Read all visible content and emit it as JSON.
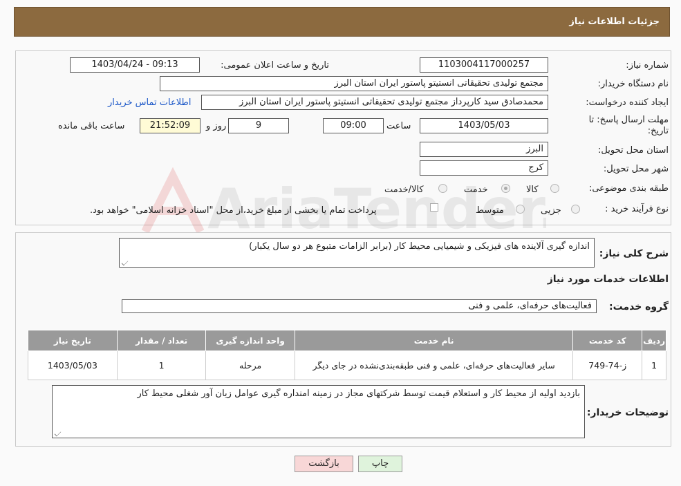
{
  "header": {
    "title": "جزئیات اطلاعات نیاز"
  },
  "need_info": {
    "need_number_label": "شماره نیاز:",
    "need_number": "1103004117000257",
    "announce_label": "تاریخ و ساعت اعلان عمومی:",
    "announce_value": "1403/04/24 - 09:13",
    "buyer_org_label": "نام دستگاه خریدار:",
    "buyer_org": "مجتمع تولیدی تحقیقاتی انستیتو پاستور ایران استان البرز",
    "requester_label": "ایجاد کننده درخواست:",
    "requester": "محمدصادق سید کارپرداز مجتمع تولیدی تحقیقاتی انستیتو پاستور ایران استان البرز",
    "contact_link": "اطلاعات تماس خریدار",
    "deadline_label_1": "مهلت ارسال پاسخ: تا",
    "deadline_label_2": "تاریخ:",
    "deadline_date": "1403/05/03",
    "time_label": "ساعت",
    "deadline_time": "09:00",
    "days_value": "9",
    "days_label": "روز و",
    "remaining_time": "21:52:09",
    "remaining_label": "ساعت باقی مانده",
    "province_label": "استان محل تحویل:",
    "province": "البرز",
    "city_label": "شهر محل تحویل:",
    "city": "کرج",
    "category_label": "طبقه بندی موضوعی:",
    "category_options": [
      "کالا",
      "خدمت",
      "کالا/خدمت"
    ],
    "category_selected": "خدمت",
    "process_label": "نوع فرآیند خرید :",
    "process_options": [
      "جزیی",
      "متوسط"
    ],
    "payment_note": "پرداخت تمام یا بخشی از مبلغ خرید،از محل \"اسناد خزانه اسلامی\" خواهد بود."
  },
  "watermark": {
    "text": "AriaTender.neT"
  },
  "description": {
    "label": "شرح کلی نیاز:",
    "value": "اندازه گیری آلاینده های فیزیکی و شیمیایی محیط کار (برابر الزامات متبوع هر دو سال یکبار)"
  },
  "services": {
    "title": "اطلاعات خدمات مورد نیاز",
    "group_label": "گروه خدمت:",
    "group_value": "فعالیت‌های حرفه‌ای، علمی و فنی",
    "columns": [
      "ردیف",
      "کد خدمت",
      "نام خدمت",
      "واحد اندازه گیری",
      "تعداد / مقدار",
      "تاریخ نیاز"
    ],
    "rows": [
      {
        "row": "1",
        "code": "ز-74-749",
        "name": "سایر فعالیت‌های حرفه‌ای، علمی و فنی طبقه‌بندی‌نشده در جای دیگر",
        "unit": "مرحله",
        "qty": "1",
        "date": "1403/05/03"
      }
    ]
  },
  "buyer_notes": {
    "label": "توضیحات خریدار:",
    "value": "بازدید اولیه از محیط کار و استعلام قیمت توسط شرکتهای مجاز در زمینه امنداره گیری عوامل زیان آور شغلی محیط کار"
  },
  "buttons": {
    "print": "چاپ",
    "back": "بازگشت"
  },
  "colors": {
    "header": "#8c6a3f",
    "back_button": "#f8d7d7",
    "print_button": "#dff3dc",
    "link": "#1a56c7"
  }
}
